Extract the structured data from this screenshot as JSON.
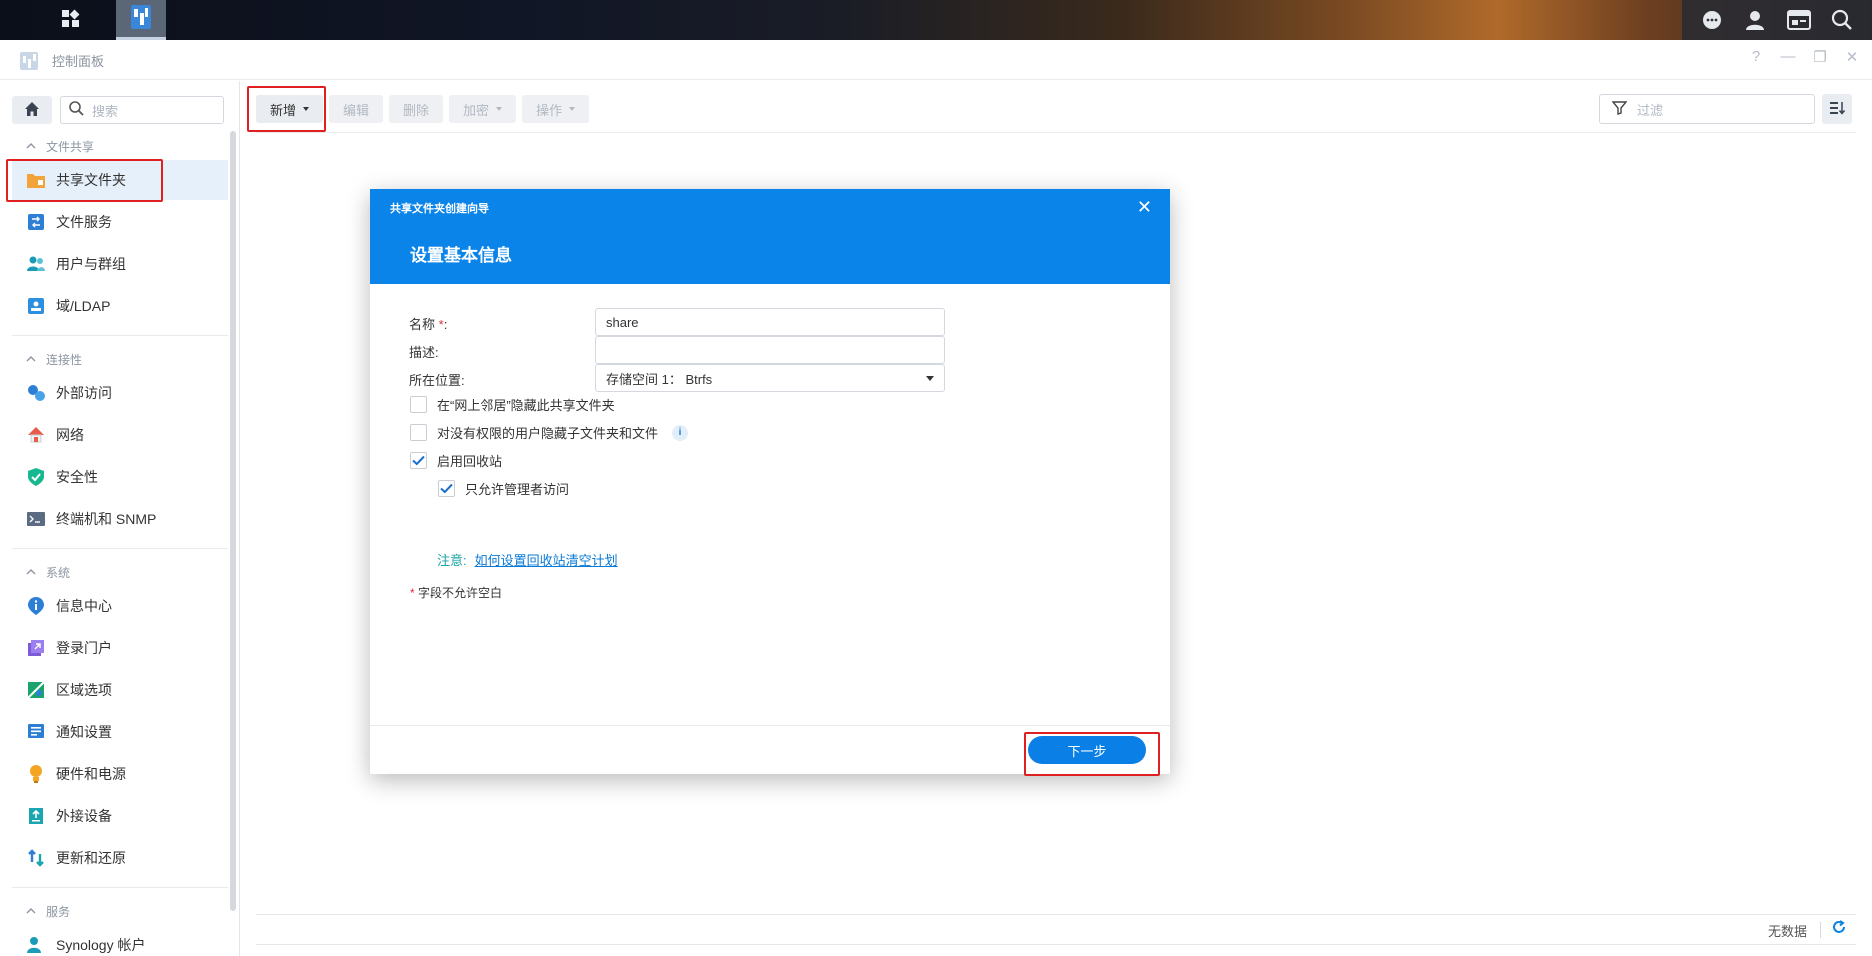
{
  "window": {
    "title": "控制面板"
  },
  "taskbar": {
    "apps_icon": "grid-icon",
    "control_panel_icon": "control-panel-icon",
    "right_icons": [
      "chat-icon",
      "user-icon",
      "widgets-icon",
      "search-icon"
    ]
  },
  "sidebar": {
    "search_placeholder": "搜索",
    "groups": {
      "file_sharing": "文件共享",
      "connectivity": "连接性",
      "system": "系统",
      "services": "服务"
    },
    "items": [
      {
        "label": "共享文件夹",
        "icon": "shared-folder-icon",
        "active": true
      },
      {
        "label": "文件服务",
        "icon": "file-services-icon"
      },
      {
        "label": "用户与群组",
        "icon": "users-groups-icon"
      },
      {
        "label": "域/LDAP",
        "icon": "domain-ldap-icon"
      },
      {
        "label": "外部访问",
        "icon": "external-access-icon"
      },
      {
        "label": "网络",
        "icon": "network-icon"
      },
      {
        "label": "安全性",
        "icon": "security-icon"
      },
      {
        "label": "终端机和 SNMP",
        "icon": "terminal-icon"
      },
      {
        "label": "信息中心",
        "icon": "info-center-icon"
      },
      {
        "label": "登录门户",
        "icon": "login-portal-icon"
      },
      {
        "label": "区域选项",
        "icon": "regional-options-icon"
      },
      {
        "label": "通知设置",
        "icon": "notification-icon"
      },
      {
        "label": "硬件和电源",
        "icon": "hardware-power-icon"
      },
      {
        "label": "外接设备",
        "icon": "external-devices-icon"
      },
      {
        "label": "更新和还原",
        "icon": "update-restore-icon"
      },
      {
        "label": "Synology 帐户",
        "icon": "synology-account-icon"
      }
    ]
  },
  "toolbar": {
    "create": "新增",
    "edit": "编辑",
    "delete": "删除",
    "encrypt": "加密",
    "action": "操作",
    "filter_placeholder": "过滤"
  },
  "footer": {
    "status": "无数据"
  },
  "dialog": {
    "wizard_title": "共享文件夹创建向导",
    "step_title": "设置基本信息",
    "name_label": "名称",
    "required_mark": "*",
    "name_suffix": ":",
    "name_value": "share",
    "desc_label": "描述:",
    "desc_value": "",
    "location_label": "所在位置:",
    "location_value": "存储空间 1： Btrfs",
    "hide_network": {
      "label": "在“网上邻居”隐藏此共享文件夹",
      "checked": false
    },
    "hide_subfolders": {
      "label": "对没有权限的用户隐藏子文件夹和文件",
      "checked": false
    },
    "recycle_bin": {
      "label": "启用回收站",
      "checked": true
    },
    "admin_only": {
      "label": "只允许管理者访问",
      "checked": true
    },
    "note_label": "注意:",
    "note_link": "如何设置回收站清空计划",
    "required_note": "字段不允许空白",
    "next": "下一步"
  }
}
